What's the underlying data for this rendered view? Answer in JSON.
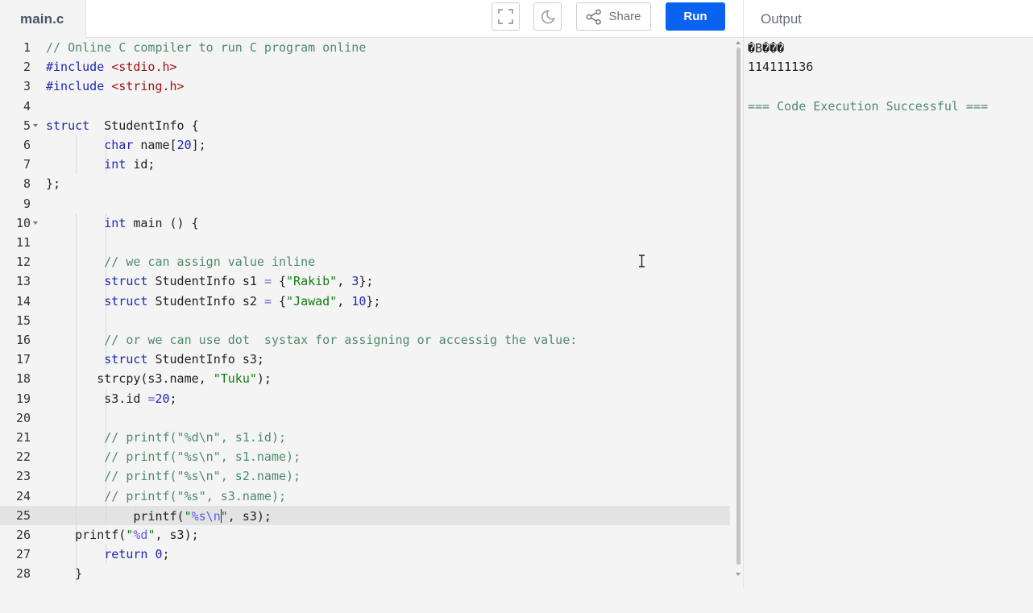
{
  "file_tab": {
    "label": "main.c"
  },
  "toolbar": {
    "share_label": "Share",
    "run_label": "Run"
  },
  "output_tab": {
    "label": "Output"
  },
  "editor": {
    "active_line": 25,
    "lines": [
      {
        "n": "1",
        "indent": 0,
        "fold": false,
        "tokens": [
          [
            "c",
            "// Online C compiler to run C program online"
          ]
        ]
      },
      {
        "n": "2",
        "indent": 0,
        "fold": false,
        "tokens": [
          [
            "k",
            "#include "
          ],
          [
            "s",
            "<stdio.h>"
          ]
        ]
      },
      {
        "n": "3",
        "indent": 0,
        "fold": false,
        "tokens": [
          [
            "k",
            "#include "
          ],
          [
            "s",
            "<string.h>"
          ]
        ]
      },
      {
        "n": "4",
        "indent": 0,
        "fold": false,
        "tokens": []
      },
      {
        "n": "5",
        "indent": 0,
        "fold": true,
        "tokens": [
          [
            "k",
            "struct"
          ],
          [
            "p",
            "  StudentInfo {"
          ]
        ]
      },
      {
        "n": "6",
        "indent": 2,
        "fold": false,
        "tokens": [
          [
            "p",
            "        "
          ],
          [
            "k",
            "char"
          ],
          [
            "p",
            " name["
          ],
          [
            "n",
            "20"
          ],
          [
            "p",
            "];"
          ]
        ]
      },
      {
        "n": "7",
        "indent": 2,
        "fold": false,
        "tokens": [
          [
            "p",
            "        "
          ],
          [
            "k",
            "int"
          ],
          [
            "p",
            " id;"
          ]
        ]
      },
      {
        "n": "8",
        "indent": 0,
        "fold": false,
        "tokens": [
          [
            "p",
            "};"
          ]
        ]
      },
      {
        "n": "9",
        "indent": 0,
        "fold": false,
        "tokens": []
      },
      {
        "n": "10",
        "indent": 2,
        "fold": true,
        "tokens": [
          [
            "p",
            "        "
          ],
          [
            "k",
            "int"
          ],
          [
            "p",
            " main () {"
          ]
        ]
      },
      {
        "n": "11",
        "indent": 2,
        "fold": false,
        "tokens": []
      },
      {
        "n": "12",
        "indent": 2,
        "fold": false,
        "tokens": [
          [
            "p",
            "        "
          ],
          [
            "c",
            "// we can assign value inline"
          ]
        ]
      },
      {
        "n": "13",
        "indent": 2,
        "fold": false,
        "tokens": [
          [
            "p",
            "        "
          ],
          [
            "k",
            "struct"
          ],
          [
            "p",
            " StudentInfo s1 "
          ],
          [
            "o",
            "="
          ],
          [
            "p",
            " {"
          ],
          [
            "str",
            "\"Rakib\""
          ],
          [
            "p",
            ", "
          ],
          [
            "n",
            "3"
          ],
          [
            "p",
            "};"
          ]
        ]
      },
      {
        "n": "14",
        "indent": 2,
        "fold": false,
        "tokens": [
          [
            "p",
            "        "
          ],
          [
            "k",
            "struct"
          ],
          [
            "p",
            " StudentInfo s2 "
          ],
          [
            "o",
            "="
          ],
          [
            "p",
            " {"
          ],
          [
            "str",
            "\"Jawad\""
          ],
          [
            "p",
            ", "
          ],
          [
            "n",
            "10"
          ],
          [
            "p",
            "};"
          ]
        ]
      },
      {
        "n": "15",
        "indent": 2,
        "fold": false,
        "tokens": []
      },
      {
        "n": "16",
        "indent": 2,
        "fold": false,
        "tokens": [
          [
            "p",
            "        "
          ],
          [
            "c",
            "// or we can use dot  systax for assigning or accessig the value:"
          ]
        ]
      },
      {
        "n": "17",
        "indent": 2,
        "fold": false,
        "tokens": [
          [
            "p",
            "        "
          ],
          [
            "k",
            "struct"
          ],
          [
            "p",
            " StudentInfo s3;"
          ]
        ]
      },
      {
        "n": "18",
        "indent": 1,
        "fold": false,
        "tokens": [
          [
            "p",
            "       "
          ],
          [
            "p",
            "strcpy(s3.name, "
          ],
          [
            "str",
            "\"Tuku\""
          ],
          [
            "p",
            ");"
          ]
        ]
      },
      {
        "n": "19",
        "indent": 2,
        "fold": false,
        "tokens": [
          [
            "p",
            "        "
          ],
          [
            "p",
            "s3.id "
          ],
          [
            "o",
            "="
          ],
          [
            "n",
            "20"
          ],
          [
            "p",
            ";"
          ]
        ]
      },
      {
        "n": "20",
        "indent": 2,
        "fold": false,
        "tokens": []
      },
      {
        "n": "21",
        "indent": 2,
        "fold": false,
        "tokens": [
          [
            "p",
            "        "
          ],
          [
            "c",
            "// printf(\"%d\\n\", s1.id);"
          ]
        ]
      },
      {
        "n": "22",
        "indent": 2,
        "fold": false,
        "tokens": [
          [
            "p",
            "        "
          ],
          [
            "c",
            "// printf(\"%s\\n\", s1.name);"
          ]
        ]
      },
      {
        "n": "23",
        "indent": 2,
        "fold": false,
        "tokens": [
          [
            "p",
            "        "
          ],
          [
            "c",
            "// printf(\"%s\\n\", s2.name);"
          ]
        ]
      },
      {
        "n": "24",
        "indent": 2,
        "fold": false,
        "tokens": [
          [
            "p",
            "        "
          ],
          [
            "c",
            "// printf(\"%s\", s3.name);"
          ]
        ]
      },
      {
        "n": "25",
        "indent": 3,
        "fold": false,
        "tokens": [
          [
            "p",
            "            "
          ],
          [
            "p",
            "printf("
          ],
          [
            "str",
            "\""
          ],
          [
            "e",
            "%s\\n"
          ],
          [
            "cursor",
            ""
          ],
          [
            "str",
            "\""
          ],
          [
            "p",
            ", s3);"
          ]
        ]
      },
      {
        "n": "26",
        "indent": 1,
        "fold": false,
        "tokens": [
          [
            "p",
            "    "
          ],
          [
            "p",
            "printf("
          ],
          [
            "str",
            "\""
          ],
          [
            "e",
            "%d"
          ],
          [
            "str",
            "\""
          ],
          [
            "p",
            ", s3);"
          ]
        ]
      },
      {
        "n": "27",
        "indent": 2,
        "fold": false,
        "tokens": [
          [
            "p",
            "        "
          ],
          [
            "k",
            "return"
          ],
          [
            "p",
            " "
          ],
          [
            "n",
            "0"
          ],
          [
            "p",
            ";"
          ]
        ]
      },
      {
        "n": "28",
        "indent": 1,
        "fold": false,
        "tokens": [
          [
            "p",
            "    "
          ],
          [
            "p",
            "}"
          ]
        ]
      }
    ]
  },
  "output": {
    "lines": [
      {
        "text": "�B���",
        "kind": "normal"
      },
      {
        "text": "114111136",
        "kind": "normal"
      },
      {
        "text": "",
        "kind": "normal"
      },
      {
        "text": "=== Code Execution Successful ===",
        "kind": "success"
      }
    ]
  }
}
